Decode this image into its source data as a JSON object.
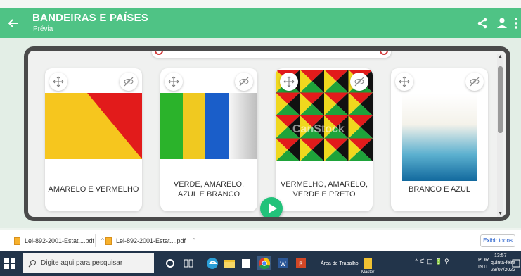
{
  "header": {
    "title": "BANDEIRAS E PAÍSES",
    "subtitle": "Prévia",
    "accent": "#4fc385"
  },
  "cards": [
    {
      "label": "AMARELO E VERMELHO",
      "colors": [
        "#f6c61e",
        "#e21b1b"
      ]
    },
    {
      "label": "VERDE, AMARELO, AZUL E BRANCO",
      "colors": [
        "#2bb32b",
        "#f0c920",
        "#1a5ec9",
        "#ffffff"
      ]
    },
    {
      "label": "VERMELHO, AMARELO, VERDE E PRETO",
      "colors": [
        "#e21b1b",
        "#f0d81e",
        "#1ea33a",
        "#111111"
      ],
      "watermark": "CanStock"
    },
    {
      "label": "BRANCO E AZUL",
      "colors": [
        "#ffffff",
        "#1e7fb0"
      ]
    }
  ],
  "downloads": {
    "items": [
      {
        "name": "Lei-892-2001-Estat....pdf"
      },
      {
        "name": "Lei-892-2001-Estat....pdf"
      }
    ],
    "show_all": "Exibir todos"
  },
  "taskbar": {
    "search_placeholder": "Digite aqui para pesquisar",
    "desktop_label": "Área de Trabalho",
    "user_label": "Master",
    "lang": "POR",
    "lang2": "INTL",
    "time": "13:57",
    "day": "quinta-feira",
    "date": "28/07/2022"
  },
  "icons": {
    "back": "arrow-left-icon",
    "share": "share-icon",
    "user": "person-icon",
    "more": "more-vertical-icon",
    "move": "move-arrows-icon",
    "hide": "eye-off-icon",
    "play": "play-icon",
    "file": "pdf-file-icon"
  }
}
